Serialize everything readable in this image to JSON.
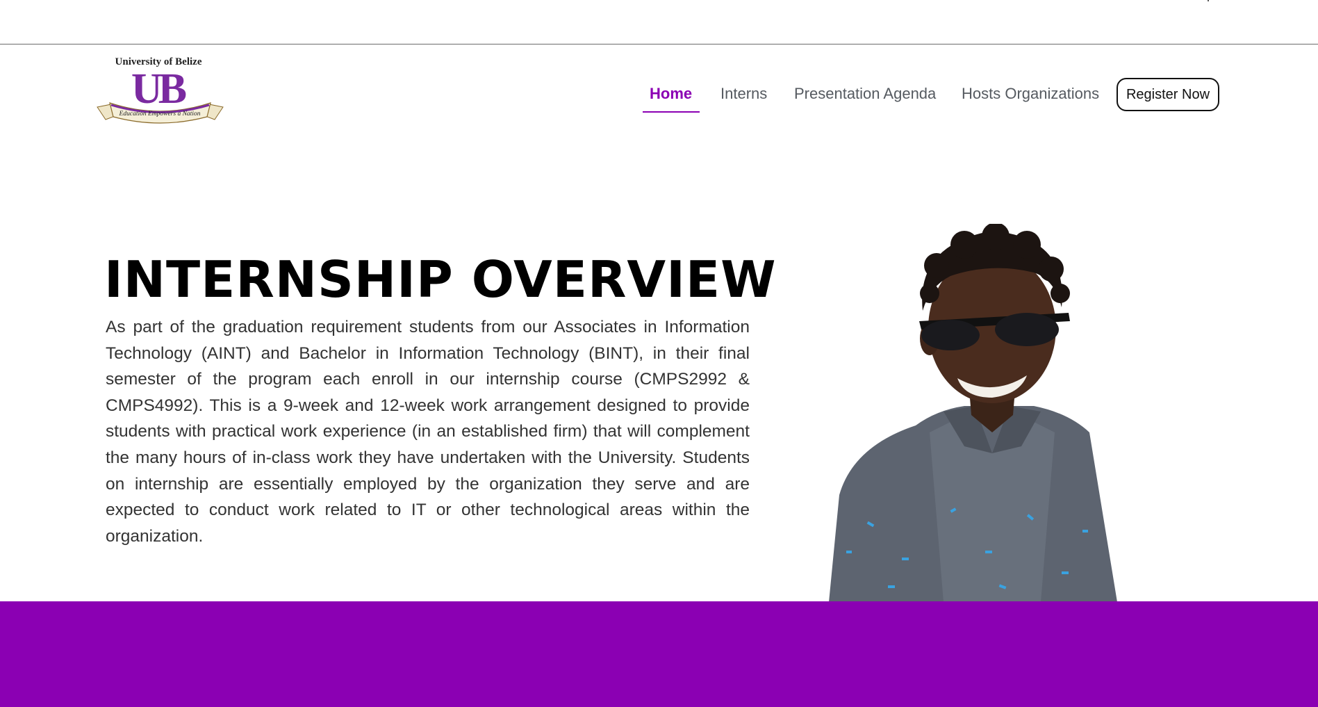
{
  "logo": {
    "university_name": "University of Belize",
    "monogram": "UB",
    "motto": "Education Empowers a Nation"
  },
  "nav": {
    "items": [
      {
        "label": "Home",
        "active": true
      },
      {
        "label": "Interns",
        "active": false
      },
      {
        "label": "Presentation Agenda",
        "active": false
      },
      {
        "label": "Hosts Organizations",
        "active": false
      }
    ],
    "cta_label": "Register Now"
  },
  "hero": {
    "title": "INTERNSHIP OVERVIEW",
    "body": "As part of the graduation requirement students from our Associates in Information Technology (AINT) and Bachelor in Information Technology (BINT), in their final semester of the program each enroll in our internship course (CMPS2992 & CMPS4992). This is a 9-week and 12-week work arrangement designed to provide students with practical work experience (in an established firm) that will complement the many hours of in-class work they have undertaken with the University. Students on internship are essentially employed by the organization they serve and are expected to conduct work related to IT or other technological areas within the organization."
  },
  "colors": {
    "brand_purple": "#8b00b3",
    "nav_text": "#555a60",
    "heading": "#000000",
    "body_text": "#333333"
  },
  "icons": {
    "photo": "student-photo"
  }
}
